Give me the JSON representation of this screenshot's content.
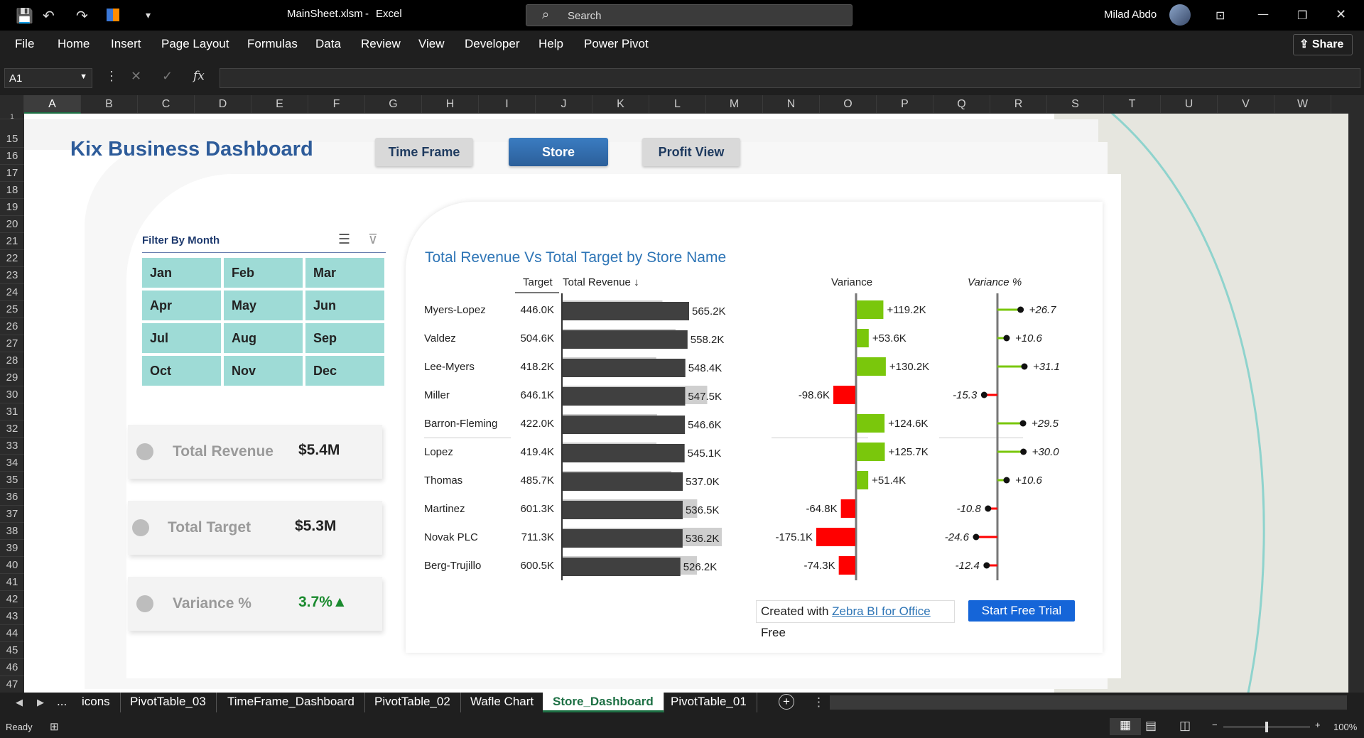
{
  "titlebar": {
    "file_name": "MainSheet.xlsm",
    "separator": "-",
    "app_name": "Excel",
    "search_placeholder": "Search",
    "user_name": "Milad Abdo"
  },
  "menu": [
    "File",
    "Home",
    "Insert",
    "Page Layout",
    "Formulas",
    "Data",
    "Review",
    "View",
    "Developer",
    "Help",
    "Power Pivot"
  ],
  "share_label": "Share",
  "formula_bar": {
    "cell_ref": "A1",
    "fx": "fx"
  },
  "columns": [
    "A",
    "B",
    "C",
    "D",
    "E",
    "F",
    "G",
    "H",
    "I",
    "J",
    "K",
    "L",
    "M",
    "N",
    "O",
    "P",
    "Q",
    "R",
    "S",
    "T",
    "U",
    "V",
    "W"
  ],
  "rows": [
    "1",
    "15",
    "16",
    "17",
    "18",
    "19",
    "20",
    "21",
    "22",
    "23",
    "24",
    "25",
    "26",
    "27",
    "28",
    "29",
    "30",
    "31",
    "32",
    "33",
    "34",
    "35",
    "36",
    "37",
    "38",
    "39",
    "40",
    "41",
    "42",
    "43",
    "44",
    "45",
    "46",
    "47"
  ],
  "dashboard": {
    "title": "Kix Business Dashboard",
    "nav": [
      "Time Frame",
      "Store",
      "Profit View"
    ],
    "filter_title": "Filter By Month",
    "months": [
      "Jan",
      "Feb",
      "Mar",
      "Apr",
      "May",
      "Jun",
      "Jul",
      "Aug",
      "Sep",
      "Oct",
      "Nov",
      "Dec"
    ],
    "kpis": [
      {
        "label": "Total Revenue",
        "value": "$5.4M"
      },
      {
        "label": "Total Target",
        "value": "$5.3M"
      },
      {
        "label": "Variance %",
        "value": "3.7%▲"
      }
    ],
    "colors": {
      "accent": "#2e5c9a",
      "positive": "#7ac70c",
      "negative": "#ff0000",
      "kpi_up": "#1a8a2e"
    }
  },
  "chart_data": {
    "type": "bar",
    "title": "Total Revenue Vs Total Target by Store Name",
    "headers": {
      "target": "Target",
      "revenue": "Total Revenue ↓",
      "variance": "Variance",
      "variance_pct": "Variance %"
    },
    "categories": [
      "Myers-Lopez",
      "Valdez",
      "Lee-Myers",
      "Miller",
      "Barron-Fleming",
      "Lopez",
      "Thomas",
      "Martinez",
      "Novak PLC",
      "Berg-Trujillo"
    ],
    "target_labels": [
      "446.0K",
      "504.6K",
      "418.2K",
      "646.1K",
      "422.0K",
      "419.4K",
      "485.7K",
      "601.3K",
      "711.3K",
      "600.5K"
    ],
    "revenue_labels": [
      "565.2K",
      "558.2K",
      "548.4K",
      "547.5K",
      "546.6K",
      "545.1K",
      "537.0K",
      "536.5K",
      "536.2K",
      "526.2K"
    ],
    "variance_labels": [
      "+119.2K",
      "+53.6K",
      "+130.2K",
      "-98.6K",
      "+124.6K",
      "+125.7K",
      "+51.4K",
      "-64.8K",
      "-175.1K",
      "-74.3K"
    ],
    "variance_pct_labels": [
      "+26.7",
      "+10.6",
      "+31.1",
      "-15.3",
      "+29.5",
      "+30.0",
      "+10.6",
      "-10.8",
      "-24.6",
      "-12.4"
    ],
    "series": [
      {
        "name": "Target",
        "values": [
          446.0,
          504.6,
          418.2,
          646.1,
          422.0,
          419.4,
          485.7,
          601.3,
          711.3,
          600.5
        ]
      },
      {
        "name": "Total Revenue",
        "values": [
          565.2,
          558.2,
          548.4,
          547.5,
          546.6,
          545.1,
          537.0,
          536.5,
          536.2,
          526.2
        ]
      },
      {
        "name": "Variance",
        "values": [
          119.2,
          53.6,
          130.2,
          -98.6,
          124.6,
          125.7,
          51.4,
          -64.8,
          -175.1,
          -74.3
        ]
      },
      {
        "name": "Variance %",
        "values": [
          26.7,
          10.6,
          31.1,
          -15.3,
          29.5,
          30.0,
          10.6,
          -10.8,
          -24.6,
          -12.4
        ]
      }
    ]
  },
  "zebra": {
    "prefix": "Created with",
    "link": "Zebra BI for Office",
    "suffix": "Free",
    "cta": "Start Free Trial"
  },
  "sheet_tabs": [
    "...",
    "icons",
    "PivotTable_03",
    "TimeFrame_Dashboard",
    "PivotTable_02",
    "Wafle Chart",
    "Store_Dashboard",
    "PivotTable_01"
  ],
  "active_tab": "Store_Dashboard",
  "status": {
    "mode": "Ready",
    "zoom": "100%"
  }
}
